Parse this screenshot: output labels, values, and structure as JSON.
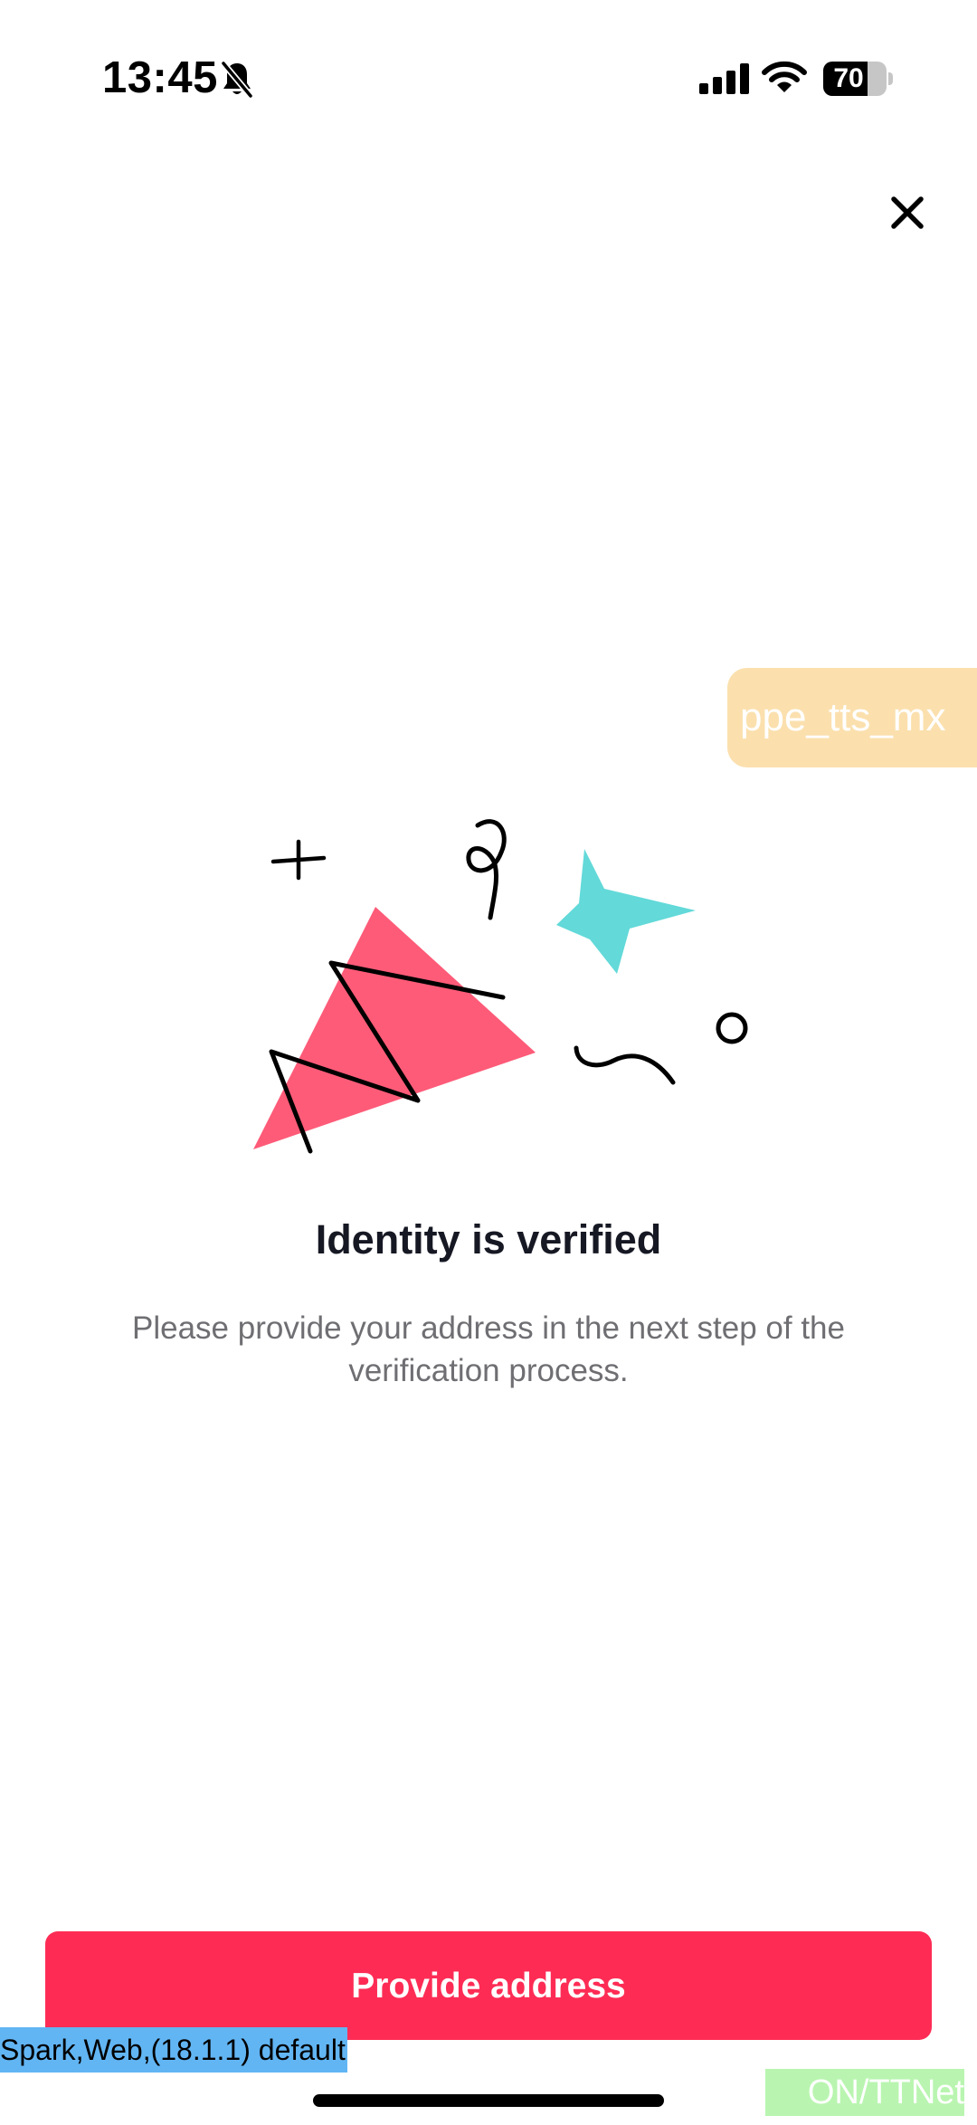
{
  "status_bar": {
    "time": "13:45",
    "battery": "70",
    "battery_level": 0.7,
    "icons": [
      "bell-slash-icon",
      "cellular-signal-icon",
      "wifi-icon",
      "battery-icon"
    ]
  },
  "header": {
    "close_icon": "close-icon"
  },
  "env_badge": {
    "label": "ppe_tts_mx"
  },
  "illustration": {
    "name": "celebration-confetti",
    "colors": {
      "triangle": "#fe5b78",
      "star": "#63d9d9",
      "strokes": "#000000"
    }
  },
  "content": {
    "title": "Identity is verified",
    "subtitle": "Please provide your address in the next step of the verification process."
  },
  "footer": {
    "primary_button_label": "Provide address"
  },
  "debug": {
    "build_label": "Spark,Web,(18.1.1) default",
    "network_label": "ON/TTNet"
  },
  "colors": {
    "accent": "#fe2c55",
    "title_text": "#161823",
    "subtitle_text": "#6f6f73",
    "badge_background": "#fbe0ae",
    "debug_label_background": "#62b5f3",
    "network_label_background": "#b9f5b0"
  }
}
